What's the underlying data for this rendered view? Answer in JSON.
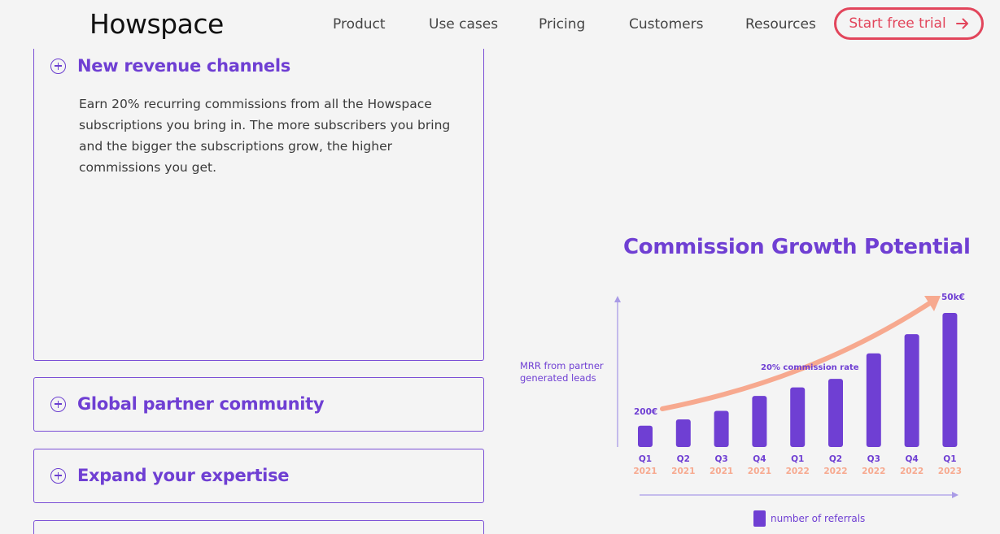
{
  "header": {
    "logo": "Howspace",
    "nav": [
      "Product",
      "Use cases",
      "Pricing",
      "Customers",
      "Resources"
    ],
    "cta_label": "Start free trial"
  },
  "accordion": [
    {
      "title": "New revenue channels",
      "body": "Earn 20% recurring commissions from all the Howspace subscriptions you bring in. The more subscribers you bring and the bigger the subscriptions grow, the higher commissions you get.",
      "expanded": true
    },
    {
      "title": "Global partner community",
      "expanded": false
    },
    {
      "title": "Expand your expertise",
      "expanded": false
    }
  ],
  "chart_data": {
    "type": "bar",
    "title": "Commission Growth Potential",
    "ylabel": "MRR from partner generated leads",
    "categories": [
      {
        "q": "Q1",
        "year": "2021"
      },
      {
        "q": "Q2",
        "year": "2021"
      },
      {
        "q": "Q3",
        "year": "2021"
      },
      {
        "q": "Q4",
        "year": "2021"
      },
      {
        "q": "Q1",
        "year": "2022"
      },
      {
        "q": "Q2",
        "year": "2022"
      },
      {
        "q": "Q3",
        "year": "2022"
      },
      {
        "q": "Q4",
        "year": "2022"
      },
      {
        "q": "Q1",
        "year": "2023"
      }
    ],
    "series": [
      {
        "name": "number of referrals",
        "values": [
          1.0,
          1.3,
          1.7,
          2.4,
          2.8,
          3.2,
          4.4,
          5.3,
          6.3
        ]
      }
    ],
    "annotations": {
      "start": "200€",
      "end": "50k€",
      "trend": "20% commission rate"
    },
    "legend": "bottom",
    "colors": {
      "bars": "#6f3fd3",
      "trend": "#f7a98f",
      "year": "#f7a98f",
      "axis": "#a99be6"
    }
  }
}
